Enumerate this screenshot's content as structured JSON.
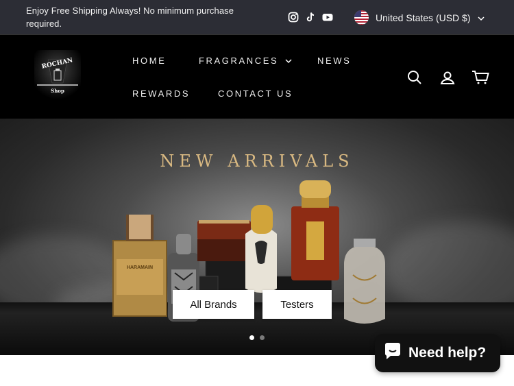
{
  "announcement": {
    "text": "Enjoy Free Shipping Always! No minimum purchase required."
  },
  "social": {
    "icons": [
      "instagram-icon",
      "tiktok-icon",
      "youtube-icon"
    ]
  },
  "locale": {
    "label": "United States (USD $)",
    "flag": "us-flag-icon"
  },
  "logo": {
    "text": "ROCHAN",
    "subtext": "Shop"
  },
  "nav": {
    "home": "HOME",
    "fragrances": "FRAGRANCES",
    "news": "NEWS",
    "rewards": "REWARDS",
    "contact": "CONTACT US"
  },
  "header_icons": [
    "search-icon",
    "account-icon",
    "cart-icon"
  ],
  "hero": {
    "title": "NEW ARRIVALS",
    "buttons": [
      "All Brands",
      "Testers"
    ],
    "slides": 2,
    "active_slide": 1
  },
  "chat": {
    "label": "Need help?"
  },
  "colors": {
    "announcement_bg": "#2c2d35",
    "header_bg": "#000000",
    "title_gold": "#d9b982"
  }
}
